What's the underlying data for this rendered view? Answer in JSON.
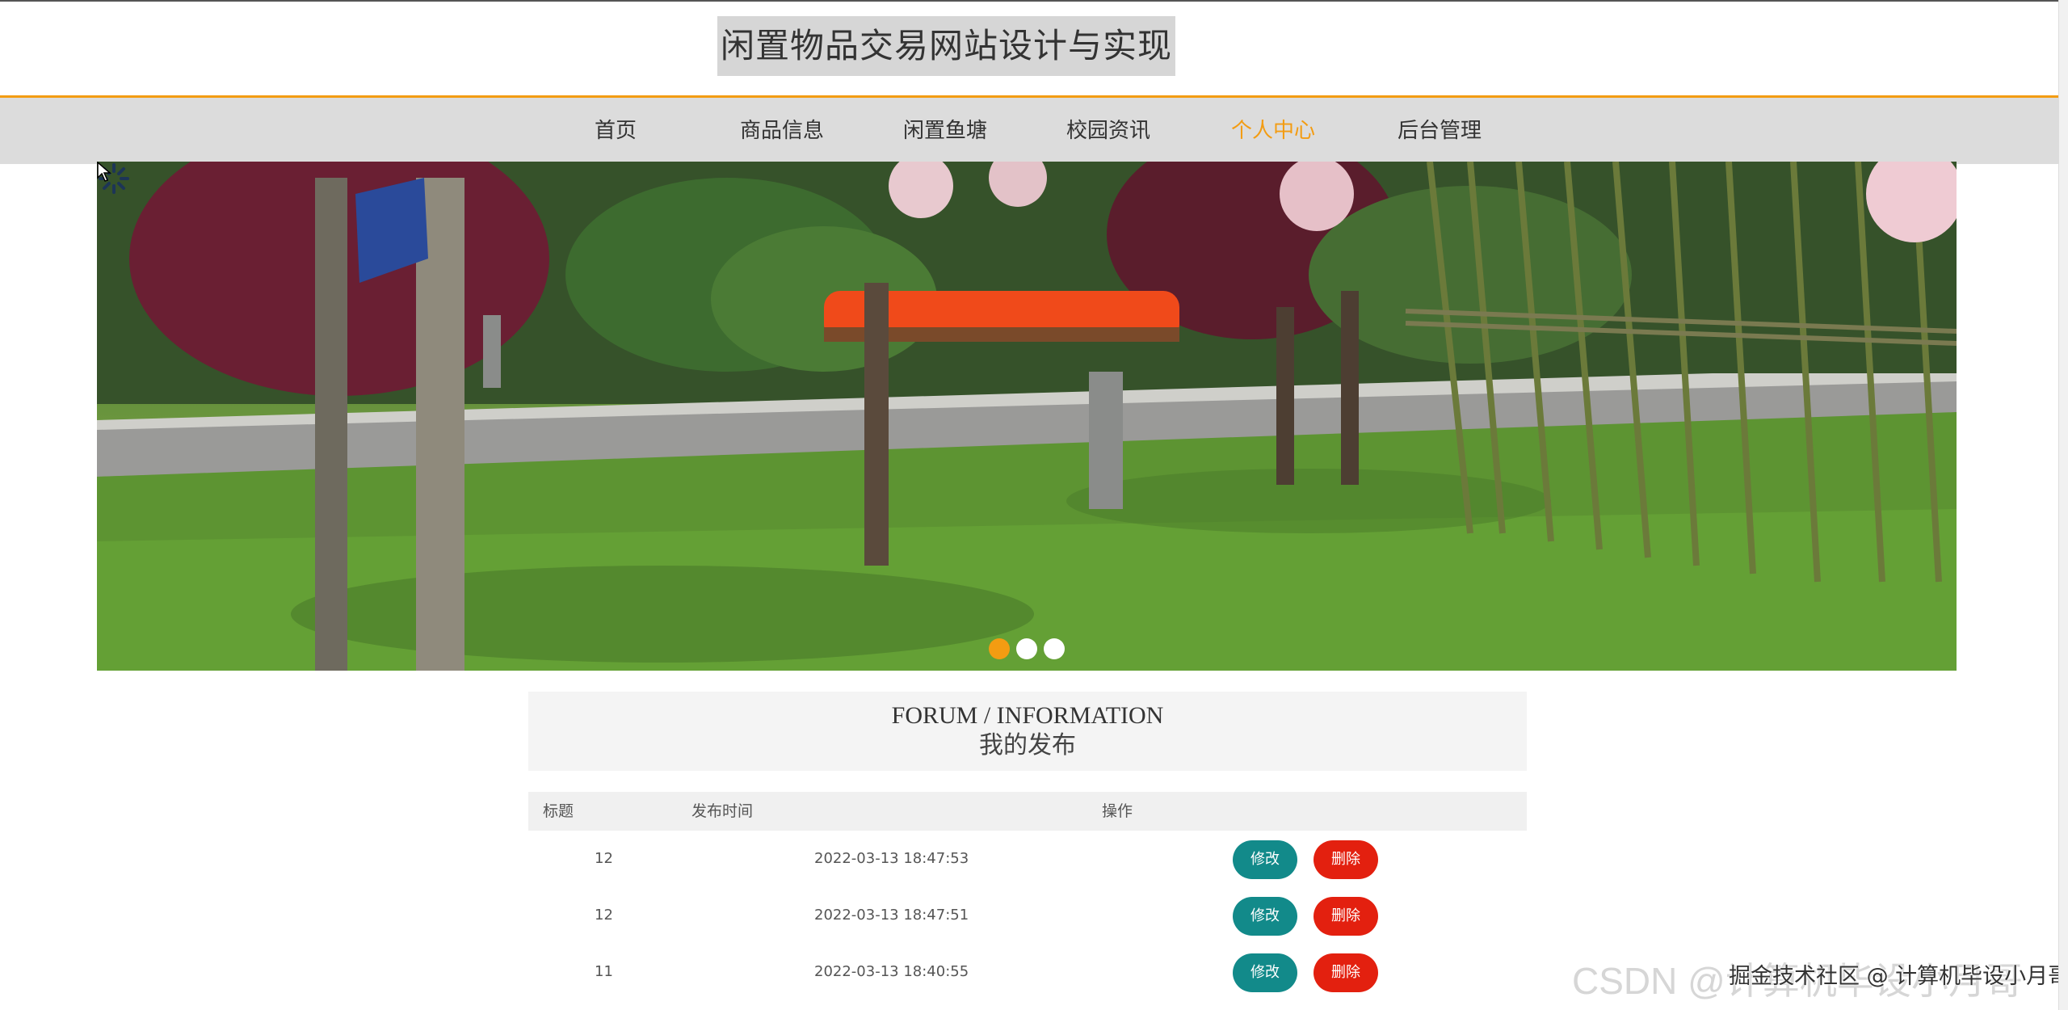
{
  "site": {
    "title": "闲置物品交易网站设计与实现"
  },
  "nav": {
    "items": [
      {
        "label": "首页"
      },
      {
        "label": "商品信息"
      },
      {
        "label": "闲置鱼塘"
      },
      {
        "label": "校园资讯"
      },
      {
        "label": "个人中心",
        "active": true
      },
      {
        "label": "后台管理"
      }
    ]
  },
  "banner": {
    "active_slide": 1,
    "slide_count": 3
  },
  "section": {
    "title_en": "FORUM / INFORMATION",
    "title_cn": "我的发布"
  },
  "table": {
    "headers": {
      "title": "标题",
      "time": "发布时间",
      "action": "操作"
    },
    "rows": [
      {
        "title": "12",
        "time": "2022-03-13 18:47:53",
        "edit": "修改",
        "delete": "删除"
      },
      {
        "title": "12",
        "time": "2022-03-13 18:47:51",
        "edit": "修改",
        "delete": "删除"
      },
      {
        "title": "11",
        "time": "2022-03-13 18:40:55",
        "edit": "修改",
        "delete": "删除"
      }
    ]
  },
  "watermark": {
    "text": "CSDN @计算机毕设小月哥",
    "overlay": "掘金技术社区 @ 计算机毕设小月哥"
  },
  "colors": {
    "accent": "#f39c12",
    "edit_button": "#128a8a",
    "delete_button": "#e3200f"
  }
}
